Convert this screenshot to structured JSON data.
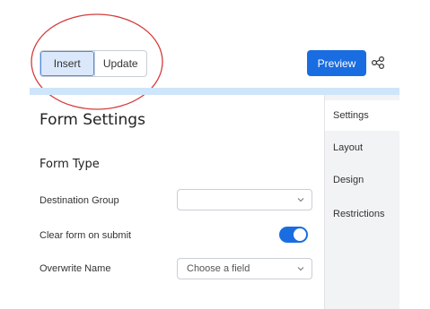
{
  "toolbar": {
    "insert_label": "Insert",
    "update_label": "Update",
    "preview_label": "Preview",
    "share_icon": "share-icon",
    "accent_color": "#1a6de0"
  },
  "annotation": {
    "color": "#d43c3c"
  },
  "sidebar": {
    "items": [
      {
        "label": "Settings",
        "active": true
      },
      {
        "label": "Layout",
        "active": false
      },
      {
        "label": "Design",
        "active": false
      },
      {
        "label": "Restrictions",
        "active": false
      }
    ]
  },
  "main": {
    "title": "Form Settings",
    "section_title": "Form Type",
    "fields": [
      {
        "label": "Destination Group",
        "type": "select",
        "value": ""
      },
      {
        "label": "Clear form on submit",
        "type": "toggle",
        "value": true
      },
      {
        "label": "Overwrite Name",
        "type": "select",
        "placeholder": "Choose a field"
      }
    ]
  }
}
